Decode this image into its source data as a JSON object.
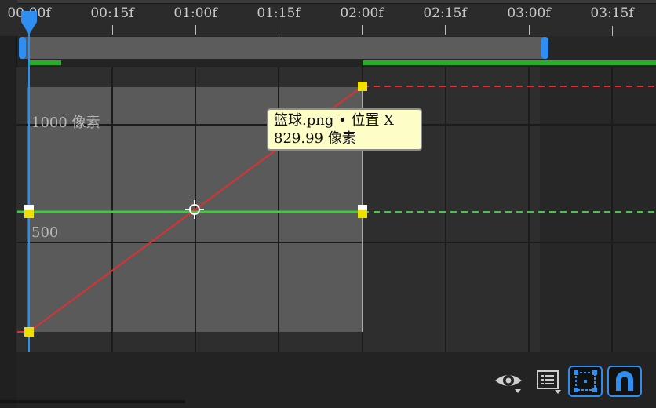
{
  "ruler": {
    "labels": [
      "00:00f",
      "00:15f",
      "01:00f",
      "01:15f",
      "02:00f",
      "02:15f",
      "03:00f",
      "03:15f"
    ]
  },
  "graph": {
    "value_label_1000": "1000 像素",
    "value_label_500": "500"
  },
  "tooltip": {
    "line1": "篮球.png • 位置 X",
    "line2": "829.99 像素"
  },
  "colors": {
    "position_x_curve": "#e03030",
    "position_y_curve": "#3ccc3c",
    "playhead": "#2f8ef0",
    "keyframe_selected": "#f0e000",
    "accent": "#2f8ef0"
  },
  "toolbar": {
    "icons": [
      "eye-visibility-icon",
      "list-menu-icon",
      "fit-selection-icon",
      "magnet-snap-icon"
    ]
  }
}
